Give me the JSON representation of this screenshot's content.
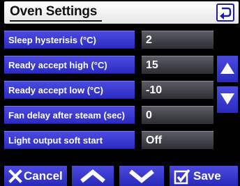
{
  "header": {
    "title": "Oven Settings",
    "back_icon": "return-arrow-icon"
  },
  "settings": [
    {
      "label": "Sleep hysterisis (°C)",
      "value": "2"
    },
    {
      "label": "Ready accept high (°C)",
      "value": "15"
    },
    {
      "label": "Ready accept low (°C)",
      "value": "-10"
    },
    {
      "label": "Fan delay after steam (sec)",
      "value": "0"
    },
    {
      "label": "Light output soft start",
      "value": "Off"
    }
  ],
  "scrollbar": {
    "up_icon": "triangle-up-icon",
    "down_icon": "triangle-down-icon"
  },
  "footer": {
    "cancel_label": "Cancel",
    "save_label": "Save",
    "cancel_icon": "x-icon",
    "up_icon": "chevron-up-icon",
    "down_icon": "chevron-down-icon",
    "save_icon": "checkbox-check-icon"
  },
  "colors": {
    "accent": "#3535d0",
    "value_bg": "#3a3a42",
    "header_bg": "#ffffff"
  }
}
